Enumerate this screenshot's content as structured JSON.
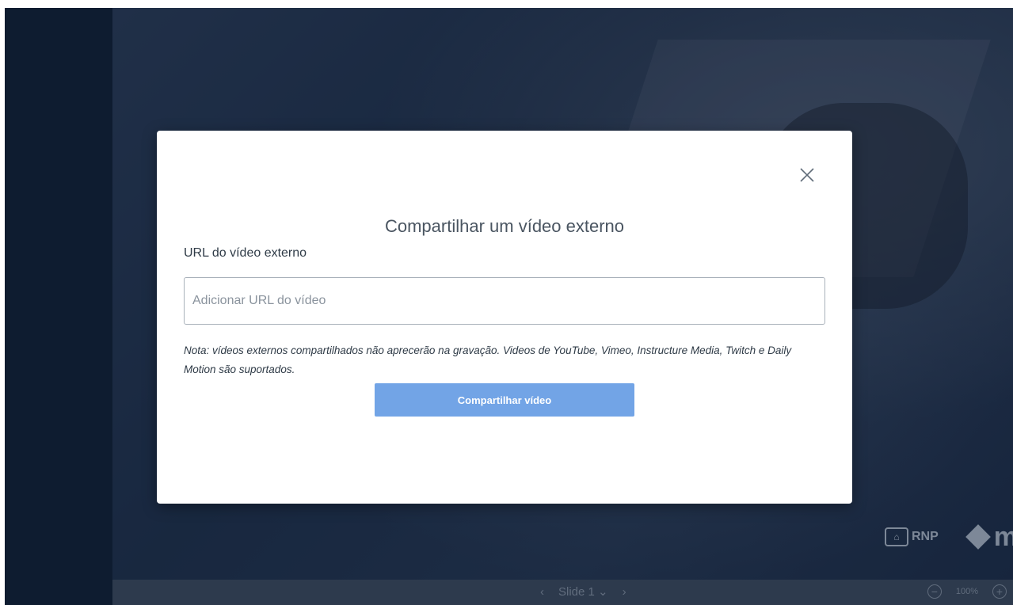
{
  "modal": {
    "title": "Compartilhar um vídeo externo",
    "url_label": "URL do vídeo externo",
    "url_placeholder": "Adicionar URL do vídeo",
    "url_value": "",
    "note": "Nota: vídeos externos compartilhados não aprecerão na gravação. Videos de YouTube, Vimeo, Instructure Media, Twitch e Daily Motion são suportados.",
    "share_button_label": "Compartilhar vídeo",
    "close_icon": "close-icon"
  },
  "presentation": {
    "slide_label": "Slide 1",
    "zoom_level": "100%",
    "logo_rnp": "RNP",
    "logo_m": "m"
  },
  "colors": {
    "accent_button": "#72a4e6",
    "app_background": "#0f1f33",
    "modal_background": "#ffffff"
  }
}
